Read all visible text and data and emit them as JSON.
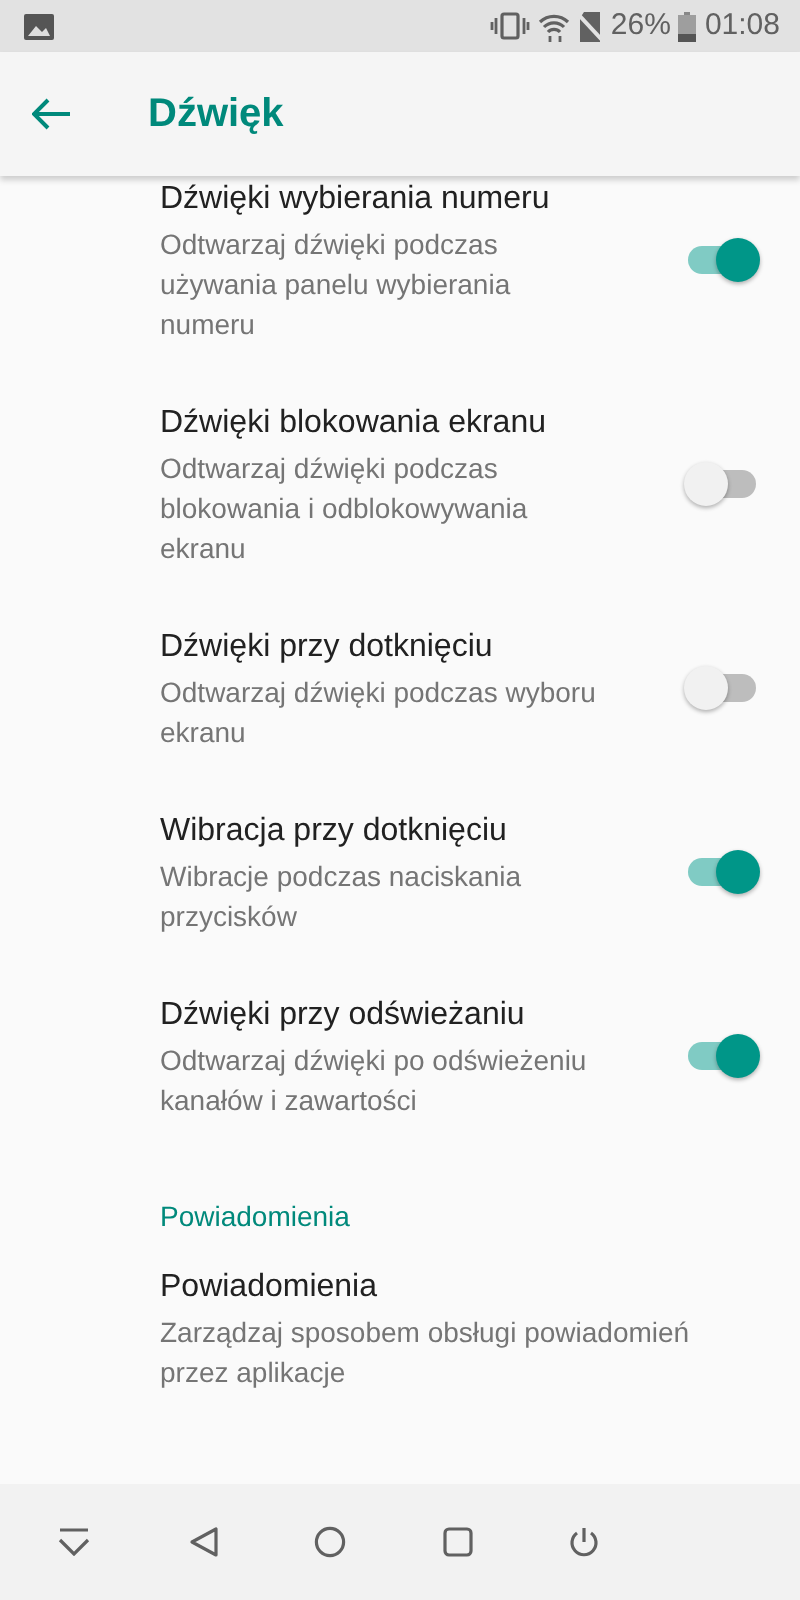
{
  "status_bar": {
    "battery_text": "26%",
    "time": "01:08"
  },
  "app_bar": {
    "title": "Dźwięk"
  },
  "settings": [
    {
      "title": "Dźwięki wybierania numeru",
      "summary": "Odtwarzaj dźwięki podczas używania panelu wybierania numeru",
      "on": true
    },
    {
      "title": "Dźwięki blokowania ekranu",
      "summary": "Odtwarzaj dźwięki podczas blokowania i odblokowywania ekranu",
      "on": false
    },
    {
      "title": "Dźwięki przy dotknięciu",
      "summary": "Odtwarzaj dźwięki podczas wyboru ekranu",
      "on": false
    },
    {
      "title": "Wibracja przy dotknięciu",
      "summary": "Wibracje podczas naciskania przycisków",
      "on": true
    },
    {
      "title": "Dźwięki przy odświeżaniu",
      "summary": "Odtwarzaj dźwięki po odświeżeniu kanałów i zawartości",
      "on": true
    }
  ],
  "section": {
    "header": "Powiadomienia",
    "items": [
      {
        "title": "Powiadomienia",
        "summary": "Zarządzaj sposobem obsługi powiadomień przez aplikacje"
      }
    ]
  }
}
